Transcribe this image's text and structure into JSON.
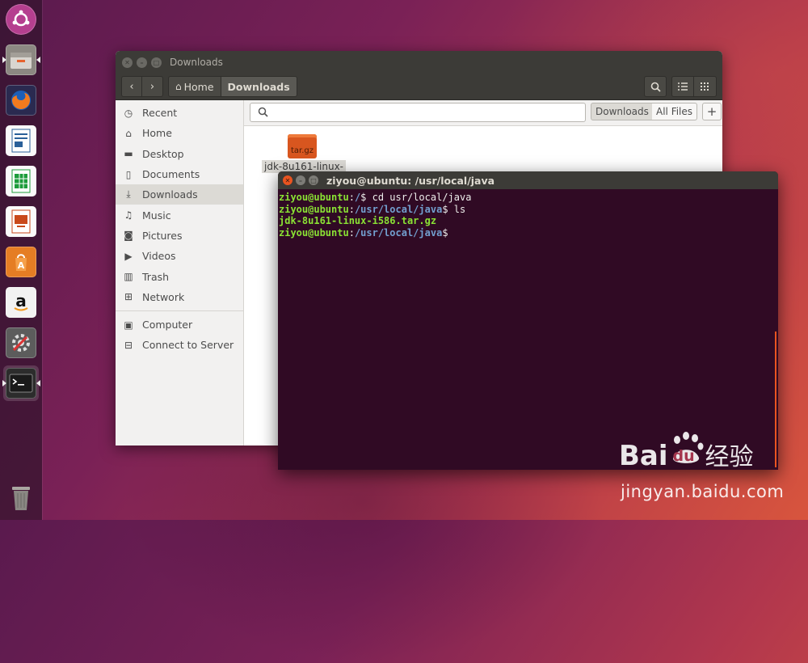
{
  "launcher": {
    "items": [
      {
        "name": "dash-home-icon",
        "color": "#c54d9a"
      },
      {
        "name": "files-app-icon",
        "color": "#8c8882"
      },
      {
        "name": "firefox-icon",
        "color": "#e66000"
      },
      {
        "name": "libreoffice-writer-icon",
        "color": "#2a6099"
      },
      {
        "name": "libreoffice-calc-icon",
        "color": "#1d9c3b"
      },
      {
        "name": "libreoffice-impress-icon",
        "color": "#c94a1c"
      },
      {
        "name": "ubuntu-software-icon",
        "color": "#e57d24"
      },
      {
        "name": "amazon-icon",
        "color": "#f2f2f2"
      },
      {
        "name": "system-settings-icon",
        "color": "#5c5c5c"
      },
      {
        "name": "terminal-icon",
        "color": "#2c2c2c"
      },
      {
        "name": "trash-icon",
        "color": "#8a8783"
      }
    ]
  },
  "files_window": {
    "title": "Downloads",
    "breadcrumb": {
      "home": "Home",
      "current": "Downloads"
    },
    "sidebar": {
      "places": [
        {
          "label": "Recent",
          "icon": "clock-icon"
        },
        {
          "label": "Home",
          "icon": "home-icon"
        },
        {
          "label": "Desktop",
          "icon": "folder-icon"
        },
        {
          "label": "Documents",
          "icon": "document-icon"
        },
        {
          "label": "Downloads",
          "icon": "download-icon",
          "selected": true
        },
        {
          "label": "Music",
          "icon": "music-icon"
        },
        {
          "label": "Pictures",
          "icon": "camera-icon"
        },
        {
          "label": "Videos",
          "icon": "video-icon"
        },
        {
          "label": "Trash",
          "icon": "trash-icon"
        },
        {
          "label": "Network",
          "icon": "network-icon"
        }
      ],
      "devices": [
        {
          "label": "Computer",
          "icon": "computer-icon"
        },
        {
          "label": "Connect to Server",
          "icon": "server-icon"
        }
      ]
    },
    "search": {
      "placeholder": "",
      "scope_downloads": "Downloads",
      "scope_all": "All Files",
      "add": "+"
    },
    "files": [
      {
        "name": "jdk-8u161-linux-",
        "badge": "tar.gz"
      }
    ]
  },
  "terminal": {
    "title": "ziyou@ubuntu: /usr/local/java",
    "lines": [
      {
        "user": "ziyou@ubuntu",
        "path": "/",
        "cmd": " cd usr/local/java"
      },
      {
        "user": "ziyou@ubuntu",
        "path": "/usr/local/java",
        "cmd": " ls"
      },
      {
        "output": "jdk-8u161-linux-i586.tar.gz"
      },
      {
        "user": "ziyou@ubuntu",
        "path": "/usr/local/java",
        "cmd": ""
      }
    ]
  },
  "watermark": {
    "brand": "Bai",
    "brand_du": "du",
    "brand_cn": "经验",
    "url": "jingyan.baidu.com"
  }
}
